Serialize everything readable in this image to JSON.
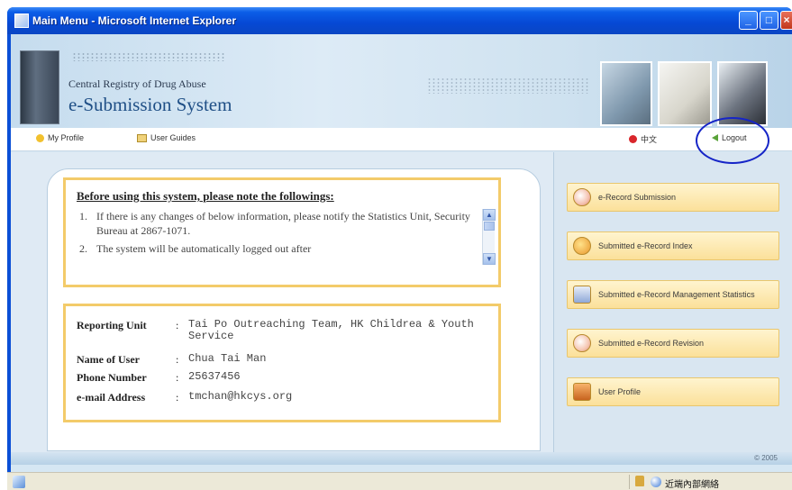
{
  "window": {
    "title": "Main Menu - Microsoft Internet Explorer",
    "min_glyph": "_",
    "max_glyph": "□",
    "close_glyph": "×"
  },
  "header": {
    "registry_name": "Central Registry of Drug Abuse",
    "system_name": "e-Submission System"
  },
  "nav": {
    "my_profile": "My Profile",
    "user_guide": "User Guides",
    "language": "中文",
    "logout": "Logout"
  },
  "notice": {
    "title": "Before using this system, please note the followings:",
    "items": [
      {
        "num": "1.",
        "text": "If there is any changes of below information, please notify the Statistics Unit, Security Bureau at 2867-1071."
      },
      {
        "num": "2.",
        "text": "The system will be automatically logged out after"
      }
    ]
  },
  "user_info": {
    "reporting_unit_label": "Reporting Unit",
    "reporting_unit": "Tai Po Outreaching Team, HK Childrea & Youth Service",
    "name_label": "Name of User",
    "name": "Chua Tai Man",
    "phone_label": "Phone Number",
    "phone": "25637456",
    "email_label": "e-mail Address",
    "email": "tmchan@hkcys.org"
  },
  "menu": {
    "items": [
      {
        "label": "e-Record Submission",
        "icon": "disc-icon"
      },
      {
        "label": "Submitted e-Record Index",
        "icon": "folder-icon"
      },
      {
        "label": "Submitted e-Record Management Statistics",
        "icon": "chart-icon"
      },
      {
        "label": "Submitted e-Record Revision",
        "icon": "revision-icon"
      },
      {
        "label": "User Profile",
        "icon": "profile-icon"
      }
    ]
  },
  "footer": {
    "copyright": "© 2005"
  },
  "statusbar": {
    "zone": "近端內部網絡"
  },
  "colors": {
    "title_bar": "#0a4fd6",
    "box_border": "#f3cb6a",
    "highlight_oval": "#1625c7"
  }
}
